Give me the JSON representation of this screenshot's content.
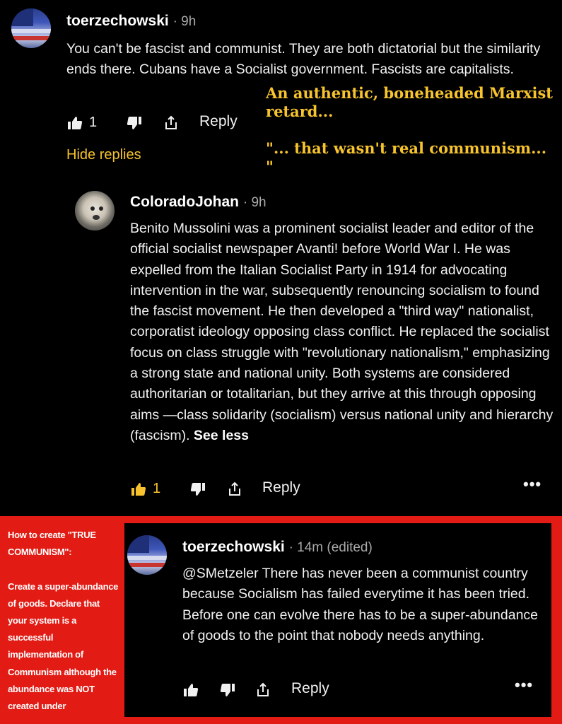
{
  "comments": [
    {
      "username": "toerzechowski",
      "time": "· 9h",
      "text": "You can't be fascist and communist. They are both dictatorial but the similarity ends there. Cubans have a Socialist government. Fascists are capitalists.",
      "likes": "1",
      "reply_label": "Reply",
      "avatar_icon": "flag-avatar"
    },
    {
      "username": "ColoradoJohan",
      "time": "· 9h",
      "text": "Benito Mussolini was a prominent socialist leader and editor of the official socialist newspaper Avanti! before World War I. He was expelled from the Italian Socialist Party in 1914 for advocating intervention in the war, subsequently renouncing socialism to found the fascist movement. He then developed a \"third way\" nationalist, corporatist ideology opposing class conflict. He replaced the socialist focus on class struggle with \"revolutionary nationalism,\" emphasizing a strong state and national unity. Both systems are considered authoritarian or totalitarian, but they arrive at this through opposing aims —class solidarity (socialism) versus national unity and hierarchy (fascism).",
      "see_less": "See less",
      "likes": "1",
      "reply_label": "Reply",
      "more_label": "•••",
      "avatar_icon": "dog-avatar"
    },
    {
      "username": "toerzechowski",
      "time": "· 14m (edited)",
      "text": "@SMetzeler There has never been a communist country because Socialism has failed everytime it has been tried. Before one can evolve there has to be a super-abundance of goods to the point that nobody needs anything.",
      "reply_label": "Reply",
      "more_label": "•••",
      "avatar_icon": "flag-avatar"
    }
  ],
  "hide_replies": "Hide replies",
  "annotation": {
    "line1": "An authentic, boneheaded Marxist retard...",
    "line2": "\"... that wasn't real communism... \""
  },
  "red_note": "How to create \"TRUE COMMUNISM\":\n\nCreate a super-abundance of goods. Declare that your system is a successful implementation of Communism although the abundance was NOT created under",
  "colors": {
    "accent_yellow": "#f7c22e",
    "panel_red": "#e21b14",
    "background": "#000000"
  }
}
